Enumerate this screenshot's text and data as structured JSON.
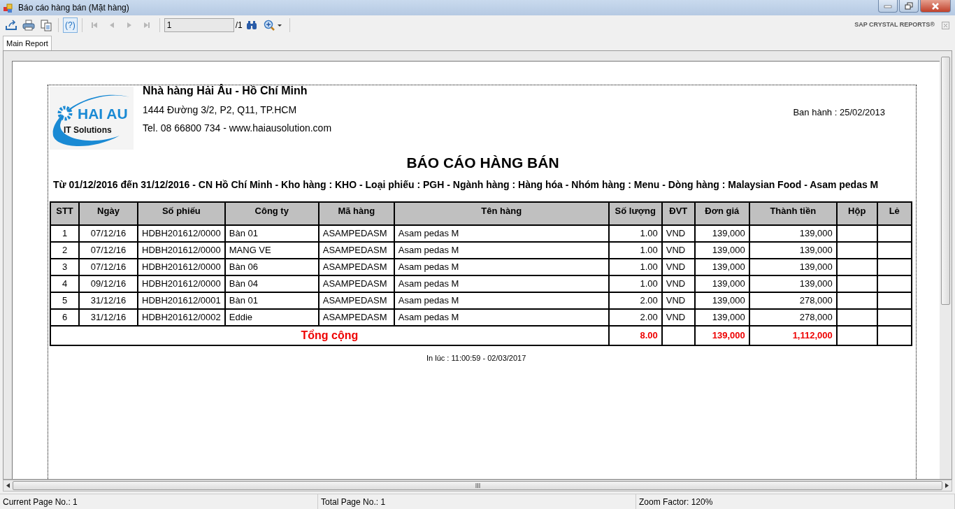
{
  "window": {
    "title": "Báo cáo hàng bán (Mặt hàng)"
  },
  "toolbar": {
    "help_label": "(?)",
    "help_active": true,
    "page_value": "1",
    "page_total": "/1",
    "brand": "SAP CRYSTAL REPORTS®"
  },
  "tabs": [
    {
      "label": "Main Report",
      "selected": true
    }
  ],
  "report": {
    "logo": {
      "name": "HAI AU",
      "tagline": "IT Solutions"
    },
    "company": "Nhà hàng Hải Âu - Hồ Chí Minh",
    "address": "1444 Đường 3/2, P2, Q11, TP.HCM",
    "contact": "Tel. 08 66800 734 - www.haiausolution.com",
    "issued": "Ban hành : 25/02/2013",
    "title": "BÁO CÁO HÀNG BÁN",
    "filter": "Từ 01/12/2016 đến 31/12/2016 - CN Hồ Chí Minh - Kho hàng : KHO - Loại phiếu : PGH - Ngành hàng : Hàng hóa - Nhóm hàng : Menu - Dòng hàng : Malaysian Food - Asam pedas M",
    "table": {
      "columns": [
        "STT",
        "Ngày",
        "Số phiếu",
        "Công ty",
        "Mã hàng",
        "Tên hàng",
        "Số lượng",
        "ĐVT",
        "Đơn giá",
        "Thành tiền",
        "Hộp",
        "Lẻ"
      ],
      "rows": [
        [
          "1",
          "07/12/16",
          "HDBH201612/0000",
          "Bàn 01",
          "ASAMPEDASM",
          "Asam pedas M",
          "1.00",
          "VND",
          "139,000",
          "139,000"
        ],
        [
          "2",
          "07/12/16",
          "HDBH201612/0000",
          "MANG VE",
          "ASAMPEDASM",
          "Asam pedas M",
          "1.00",
          "VND",
          "139,000",
          "139,000"
        ],
        [
          "3",
          "07/12/16",
          "HDBH201612/0000",
          "Bàn 06",
          "ASAMPEDASM",
          "Asam pedas M",
          "1.00",
          "VND",
          "139,000",
          "139,000"
        ],
        [
          "4",
          "09/12/16",
          "HDBH201612/0000",
          "Bàn 04",
          "ASAMPEDASM",
          "Asam pedas M",
          "1.00",
          "VND",
          "139,000",
          "139,000"
        ],
        [
          "5",
          "31/12/16",
          "HDBH201612/0001",
          "Bàn 01",
          "ASAMPEDASM",
          "Asam pedas M",
          "2.00",
          "VND",
          "139,000",
          "278,000"
        ],
        [
          "6",
          "31/12/16",
          "HDBH201612/0002",
          "Eddie",
          "ASAMPEDASM",
          "Asam pedas M",
          "2.00",
          "VND",
          "139,000",
          "278,000"
        ]
      ],
      "total": {
        "label": "Tổng cộng",
        "quantity": "8.00",
        "unit_price": "139,000",
        "amount": "1,112,000"
      }
    },
    "printed_at": "In lúc : 11:00:59 - 02/03/2017"
  },
  "status_bar": [
    "Current Page No.: 1",
    "Total Page No.: 1",
    "Zoom Factor: 120%"
  ]
}
